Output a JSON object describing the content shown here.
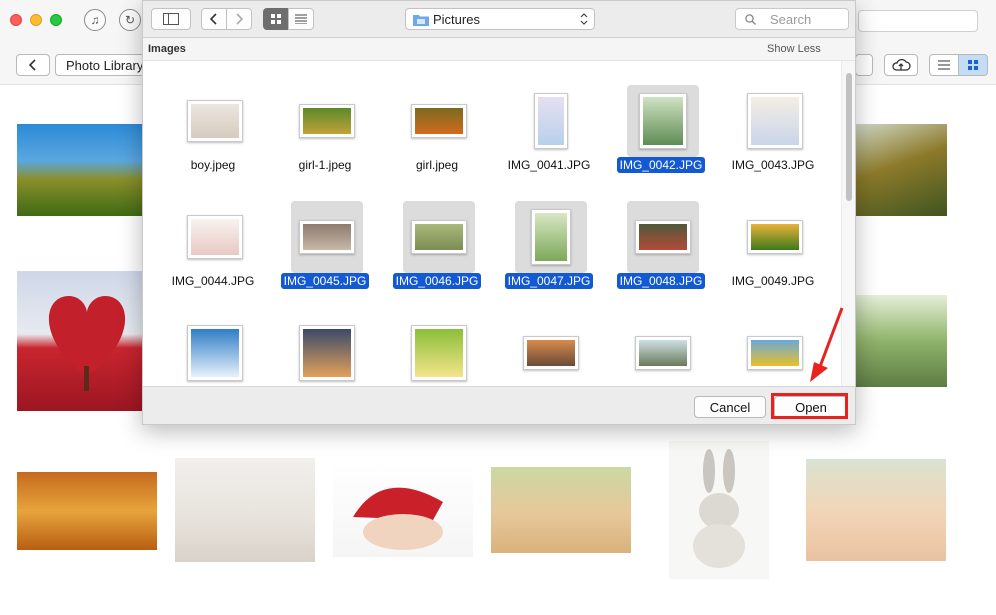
{
  "background_app": {
    "toolbar": {
      "breadcrumb_label": "Photo Library"
    }
  },
  "dialog": {
    "location": "Pictures",
    "search_placeholder": "Search",
    "section": {
      "title": "Images",
      "toggle": "Show Less"
    },
    "files": [
      {
        "name": "boy.jpeg",
        "selected": false
      },
      {
        "name": "girl-1.jpeg",
        "selected": false
      },
      {
        "name": "girl.jpeg",
        "selected": false
      },
      {
        "name": "IMG_0041.JPG",
        "selected": false
      },
      {
        "name": "IMG_0042.JPG",
        "selected": true
      },
      {
        "name": "IMG_0043.JPG",
        "selected": false
      },
      {
        "name": "IMG_0044.JPG",
        "selected": false
      },
      {
        "name": "IMG_0045.JPG",
        "selected": true
      },
      {
        "name": "IMG_0046.JPG",
        "selected": true
      },
      {
        "name": "IMG_0047.JPG",
        "selected": true
      },
      {
        "name": "IMG_0048.JPG",
        "selected": true
      },
      {
        "name": "IMG_0049.JPG",
        "selected": false
      },
      {
        "name": "",
        "selected": false
      },
      {
        "name": "",
        "selected": false
      },
      {
        "name": "",
        "selected": false
      },
      {
        "name": "",
        "selected": false
      },
      {
        "name": "",
        "selected": false
      },
      {
        "name": "",
        "selected": false
      }
    ],
    "buttons": {
      "cancel": "Cancel",
      "open": "Open"
    }
  },
  "colors": {
    "selection": "#1359d1",
    "highlight": "#e8231f"
  }
}
